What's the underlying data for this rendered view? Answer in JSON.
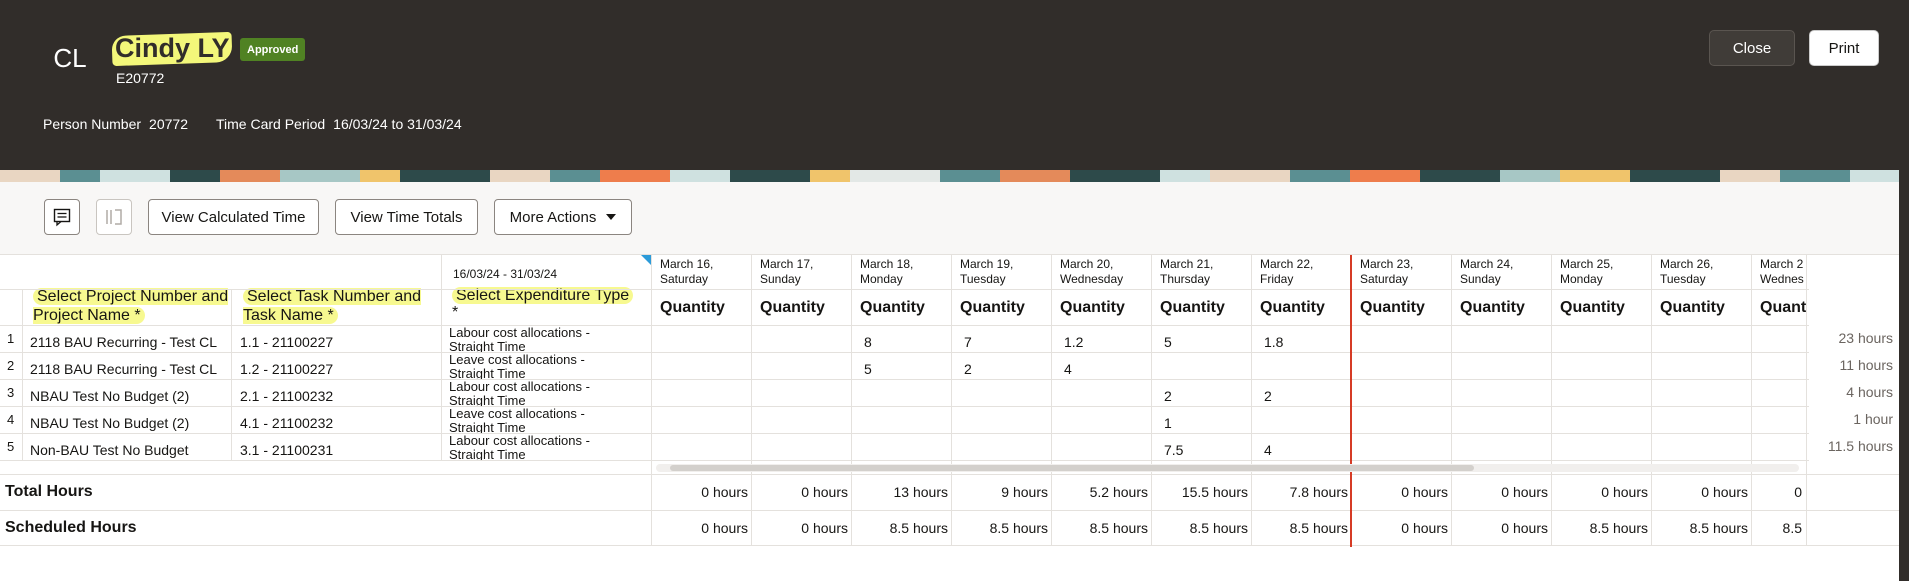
{
  "header": {
    "initials": "CL",
    "name": "Cindy LY",
    "status": "Approved",
    "employee_id": "E20772",
    "person_number_label": "Person Number",
    "person_number": "20772",
    "period_label": "Time Card Period",
    "period": "16/03/24 to 31/03/24",
    "close_label": "Close",
    "print_label": "Print"
  },
  "toolbar": {
    "calc_label": "View Calculated Time",
    "totals_label": "View Time Totals",
    "more_label": "More Actions"
  },
  "grid": {
    "range": "16/03/24 - 31/03/24",
    "col_project": "Select Project Number and Project Name *",
    "col_task": "Select Task Number and Task Name *",
    "col_exp": "Select Expenditure Type",
    "col_exp_star": "*",
    "qty_label": "Quantity",
    "days": [
      {
        "date": "March 16,",
        "day": "Saturday"
      },
      {
        "date": "March 17,",
        "day": "Sunday"
      },
      {
        "date": "March 18,",
        "day": "Monday"
      },
      {
        "date": "March 19,",
        "day": "Tuesday"
      },
      {
        "date": "March 20,",
        "day": "Wednesday"
      },
      {
        "date": "March 21,",
        "day": "Thursday"
      },
      {
        "date": "March 22,",
        "day": "Friday"
      },
      {
        "date": "March 23,",
        "day": "Saturday"
      },
      {
        "date": "March 24,",
        "day": "Sunday"
      },
      {
        "date": "March 25,",
        "day": "Monday"
      },
      {
        "date": "March 26,",
        "day": "Tuesday"
      },
      {
        "date": "March 2",
        "day": "Wednes"
      }
    ],
    "rows": [
      {
        "n": "1",
        "project": "2118 BAU Recurring - Test CL",
        "task": "1.1 - 21100227",
        "exp1": "Labour cost allocations -",
        "exp2": "Straight Time",
        "d2": "8",
        "d3": "7",
        "d4": "1.2",
        "d5": "5",
        "d6": "1.8",
        "total": "23 hours"
      },
      {
        "n": "2",
        "project": "2118 BAU Recurring - Test CL",
        "task": "1.2 - 21100227",
        "exp1": "Leave cost allocations -",
        "exp2": "Straight Time",
        "d2": "5",
        "d3": "2",
        "d4": "4",
        "d5": "",
        "d6": "",
        "total": "11 hours"
      },
      {
        "n": "3",
        "project": "NBAU Test No Budget (2)",
        "task": "2.1 - 21100232",
        "exp1": "Labour cost allocations -",
        "exp2": "Straight Time",
        "d2": "",
        "d3": "",
        "d4": "",
        "d5": "2",
        "d6": "2",
        "total": "4 hours"
      },
      {
        "n": "4",
        "project": "NBAU Test No Budget (2)",
        "task": "4.1 - 21100232",
        "exp1": "Leave cost allocations -",
        "exp2": "Straight Time",
        "d2": "",
        "d3": "",
        "d4": "",
        "d5": "1",
        "d6": "",
        "total": "1 hour"
      },
      {
        "n": "5",
        "project": "Non-BAU Test No Budget",
        "task": "3.1 - 21100231",
        "exp1": "Labour cost allocations -",
        "exp2": "Straight Time",
        "d2": "",
        "d3": "",
        "d4": "",
        "d5": "7.5",
        "d6": "4",
        "total": "11.5 hours"
      }
    ],
    "total_hours_label": "Total Hours",
    "total_hours": [
      "0 hours",
      "0 hours",
      "13 hours",
      "9 hours",
      "5.2 hours",
      "15.5 hours",
      "7.8 hours",
      "0 hours",
      "0 hours",
      "0 hours",
      "0 hours",
      "0"
    ],
    "scheduled_label": "Scheduled Hours",
    "scheduled_hours": [
      "0 hours",
      "0 hours",
      "8.5 hours",
      "8.5 hours",
      "8.5 hours",
      "8.5 hours",
      "8.5 hours",
      "0 hours",
      "0 hours",
      "8.5 hours",
      "8.5 hours",
      "8.5"
    ]
  }
}
